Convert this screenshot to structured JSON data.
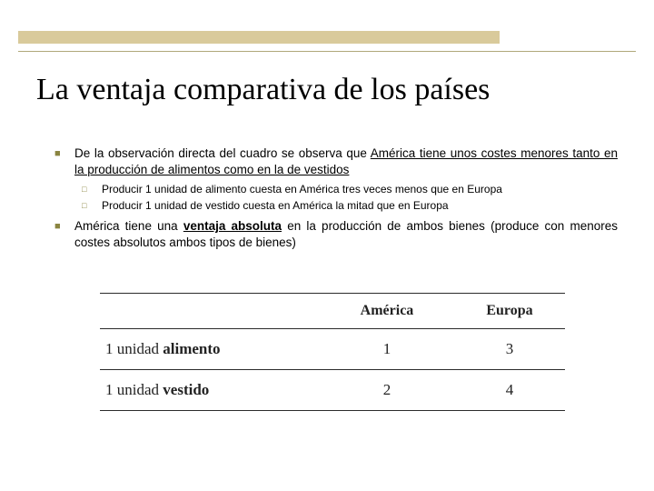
{
  "title": "La ventaja comparativa de los países",
  "bullets": {
    "b1_pre": "De la observación directa del cuadro se observa que ",
    "b1_ul": "América tiene unos costes menores tanto en la producción de alimentos como en la de vestidos",
    "b1a": "Producir 1 unidad de alimento cuesta en América tres veces menos que en Europa",
    "b1b": "Producir 1 unidad de vestido cuesta en América la mitad que en Europa",
    "b2_pre": "América tiene una ",
    "b2_term": "ventaja absoluta",
    "b2_post": " en la producción de ambos bienes (produce con menores costes absolutos ambos tipos de bienes)"
  },
  "chart_data": {
    "type": "table",
    "columns": [
      "",
      "América",
      "Europa"
    ],
    "rows": [
      {
        "label_pre": "1 unidad ",
        "label_bold": "alimento",
        "america": "1",
        "europa": "3"
      },
      {
        "label_pre": "1 unidad ",
        "label_bold": "vestido",
        "america": "2",
        "europa": "4"
      }
    ]
  }
}
